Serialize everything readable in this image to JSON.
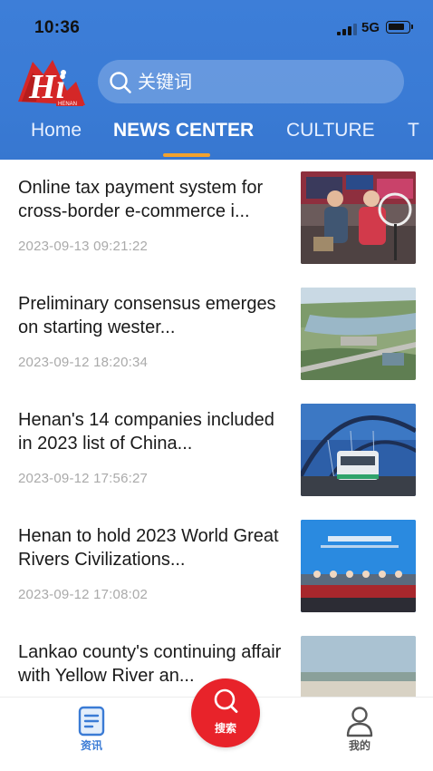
{
  "status_bar": {
    "time": "10:36",
    "network": "5G"
  },
  "search": {
    "placeholder": "关键词"
  },
  "tabs": [
    {
      "label": "Home"
    },
    {
      "label": "NEWS CENTER",
      "active": true
    },
    {
      "label": "CULTURE"
    },
    {
      "label": "T"
    }
  ],
  "news": [
    {
      "title": "Online tax payment system for cross-border e-commerce i...",
      "date": "2023-09-13 09:21:22"
    },
    {
      "title": "Preliminary consensus emerges on starting wester...",
      "date": "2023-09-12 18:20:34"
    },
    {
      "title": "Henan's 14 companies included in 2023 list of China...",
      "date": "2023-09-12 17:56:27"
    },
    {
      "title": "Henan to hold 2023 World Great Rivers Civilizations...",
      "date": "2023-09-12 17:08:02"
    },
    {
      "title": "Lankao county's continuing affair with Yellow River an...",
      "date": ""
    }
  ],
  "bottom_nav": {
    "news_label": "资讯",
    "search_label": "搜索",
    "me_label": "我的"
  },
  "colors": {
    "header_blue": "#3a7bd5",
    "tab_indicator": "#f2a22e",
    "search_fab": "#e8232a"
  }
}
